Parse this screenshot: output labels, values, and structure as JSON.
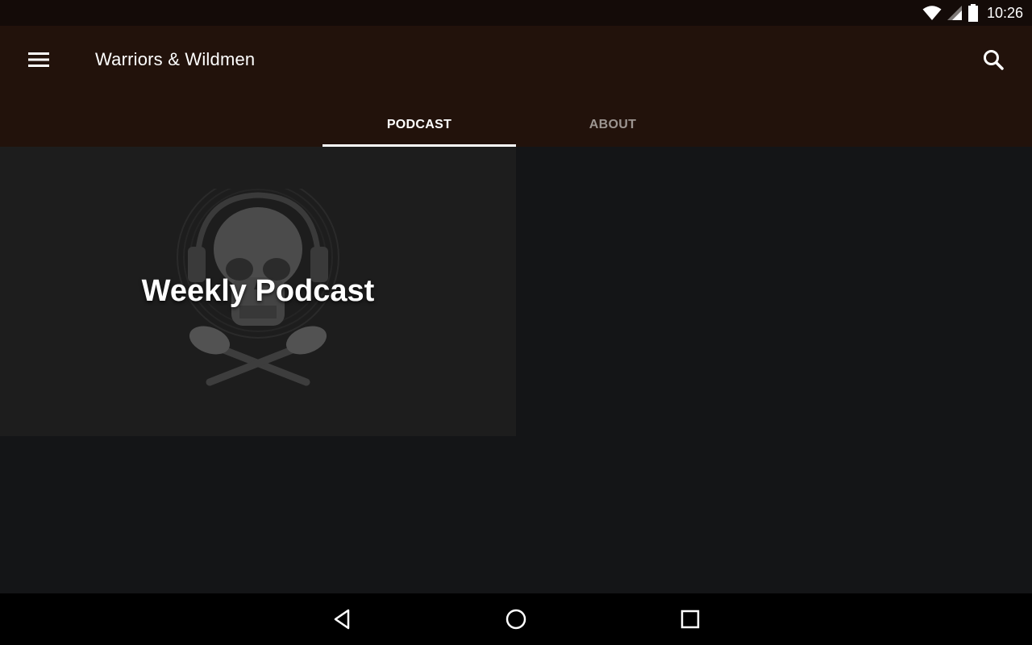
{
  "status_bar": {
    "time": "10:26",
    "icons": [
      "wifi-icon",
      "signal-icon",
      "battery-icon"
    ]
  },
  "app_bar": {
    "title": "Warriors & Wildmen",
    "menu_icon": "menu-icon",
    "search_icon": "search-icon",
    "background": "#22120b"
  },
  "tabs": [
    {
      "label": "PODCAST",
      "active": true
    },
    {
      "label": "ABOUT",
      "active": false
    }
  ],
  "content": {
    "cards": [
      {
        "title": "Weekly Podcast",
        "image": "skull-headphones-microphones-logo"
      }
    ]
  },
  "nav_bar": {
    "buttons": [
      "back-icon",
      "home-icon",
      "recents-icon"
    ]
  }
}
